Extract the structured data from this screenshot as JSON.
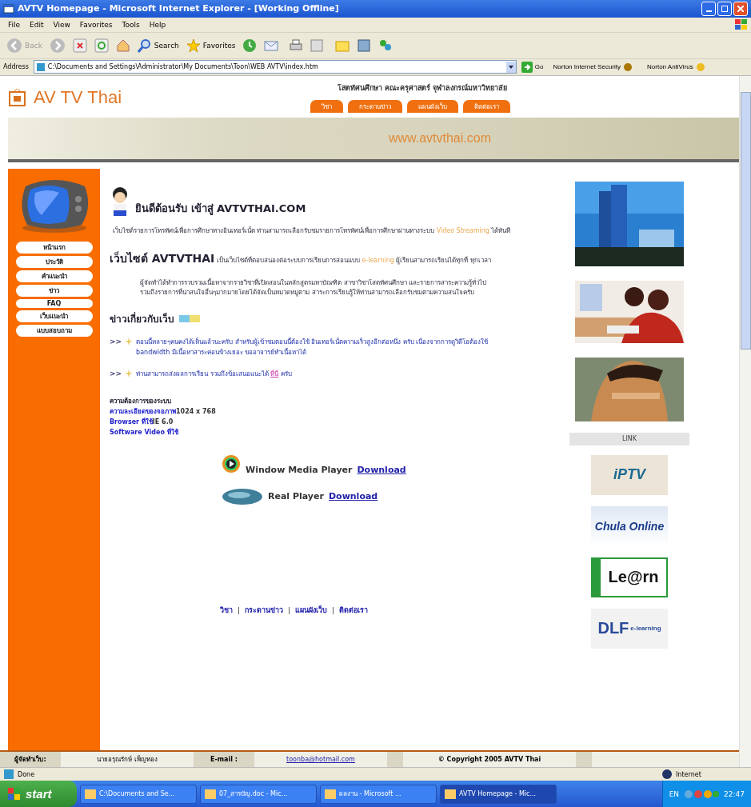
{
  "window": {
    "title": "AVTV Homepage - Microsoft Internet Explorer - [Working Offline]"
  },
  "menu": [
    "File",
    "Edit",
    "View",
    "Favorites",
    "Tools",
    "Help"
  ],
  "toolbar": {
    "back": "Back",
    "search": "Search",
    "favorites": "Favorites"
  },
  "address": {
    "label": "Address",
    "value": "C:\\Documents and Settings\\Administrator\\My Documents\\Toon\\WEB AVTV\\index.htm",
    "go": "Go",
    "addons": [
      "Norton Internet Security",
      "Norton AntiVirus"
    ]
  },
  "site": {
    "logo": "AV TV Thai",
    "department": "โสตทัศนศึกษา คณะครุศาสตร์ จุฬาลงกรณ์มหาวิทยาลัย",
    "tabs": [
      "วิชา",
      "กระดานข่าว",
      "แผนผังเว็บ",
      "ติดต่อเรา"
    ],
    "url": "www.avtvthai.com",
    "sidebar": [
      "หน้าแรก",
      "ประวัติ",
      "คำแนะนำ",
      "ข่าว",
      "FAQ",
      "เว็บแนะนำ",
      "แบบสอบถาม"
    ],
    "welcome": "ยินดีต้อนรับ เข้าสู่ AVTVTHAI.COM",
    "intro": {
      "text": "เว็บไซต์รายการโทรทัศน์เพื่อการศึกษาทางอินเทอร์เน็ต ท่านสามารถเลือกรับชมรายการโทรทัศน์เพื่อการศึกษาผ่านทางระบบ",
      "highlight": "Video Streaming",
      "after": "ได้ทันที"
    },
    "about": {
      "lead": "เว็บไซต์ AVTVTHAI",
      "before": "เป็นเว็บไซต์ที่ตอบสนองต่อระบบการเรียนการสอนแบบ",
      "highlight": "e-learning",
      "after": "ผู้เรียนสามารถเรียนได้ทุกที่ ทุกเวลา"
    },
    "description": "ผู้จัดทำได้ทำการรวบรวมเนื้อหาจากรายวิชาที่เปิดสอนในหลักสูตรมหาบัณฑิต สาขาวิชาโสตทัศนศึกษา และรายการสาระความรู้ทั่วไป รวมถึงรายการที่น่าสนใจอื่นๆมากมายโดยได้จัดเป็นหมวดหมู่ตาม สาระการเรียนรู้ให้ท่านสามารถเลือกรับชมตามความสนใจครับ",
    "news_title": "ข่าวเกี่ยวกับเว็บ",
    "news": [
      {
        "marker": ">>",
        "text": "ตอนนี้หลายๆคนคงได้เห็นแล้วนะครับ สำหรับผู้เข้าชมตอนนี้ต้องใช้ อินเทอร์เน็ตความเร็วสูงอีกต่อหนึ่ง ครับ เนื่องจากการดูวิดีโอต้องใช้ bandwidth มีเนื้อหาสาระค่อนข้างเยอะ ขออาจารย์ทำเนื้อหาได้"
      },
      {
        "marker": ">>",
        "text": "ท่านสามารถส่งผลการเรียน รวมถึงข้อเสนอแนะได้",
        "link": "ที่นี่",
        "after": "ครับ"
      }
    ],
    "requirements": {
      "title": "ความต้องการของระบบ",
      "rows": [
        {
          "label": "ความละเอียดของจอภาพ",
          "value": "1024 x 768"
        },
        {
          "label": "Browser ที่ใช้",
          "value": "IE 6.0"
        },
        {
          "label": "Software Video ที่ใช้"
        }
      ]
    },
    "players": [
      {
        "kind": "wmp",
        "name": "Window Media Player",
        "link": "Download"
      },
      {
        "kind": "real",
        "name": "Real Player",
        "link": "Download"
      }
    ],
    "footer_links": [
      {
        "kind": "link",
        "text": "วิชา"
      },
      {
        "kind": "separator",
        "text": "|"
      },
      {
        "kind": "link",
        "text": "กระดานข่าว"
      },
      {
        "kind": "separator",
        "text": "|"
      },
      {
        "kind": "link",
        "text": "แผนผังเว็บ"
      },
      {
        "kind": "separator",
        "text": "|"
      },
      {
        "kind": "link",
        "text": "ติดต่อเรา"
      }
    ],
    "link_title": "LINK",
    "links": [
      {
        "kind": "iptv",
        "text": "iPTV"
      },
      {
        "kind": "chula",
        "text": "Chula Online"
      },
      {
        "kind": "learn",
        "text": "Le@rn"
      },
      {
        "kind": "dlf",
        "text": "DLF",
        "sub": "e-learning"
      }
    ],
    "bottom_bar": {
      "author_label": "ผู้จัดทำเว็บ:",
      "author": "นายอรุณรักษ์ เพ็ญทอง",
      "email_label": "E-mail :",
      "email": "toonba@hotmail.com",
      "copyright": "© Copyright 2005 AVTV Thai"
    }
  },
  "status_bar": {
    "text": "Done",
    "zone": "Internet"
  },
  "taskbar": {
    "start": "start",
    "tasks": [
      {
        "label": "C:\\Documents and Se...",
        "selected": false
      },
      {
        "label": "07_สารบัญ.doc - Mic...",
        "selected": false
      },
      {
        "label": "ผลงาน - Microsoft ...",
        "selected": false
      },
      {
        "label": "AVTV Homepage - Mic...",
        "selected": true
      }
    ],
    "lang": "EN",
    "clock": "22:47"
  }
}
